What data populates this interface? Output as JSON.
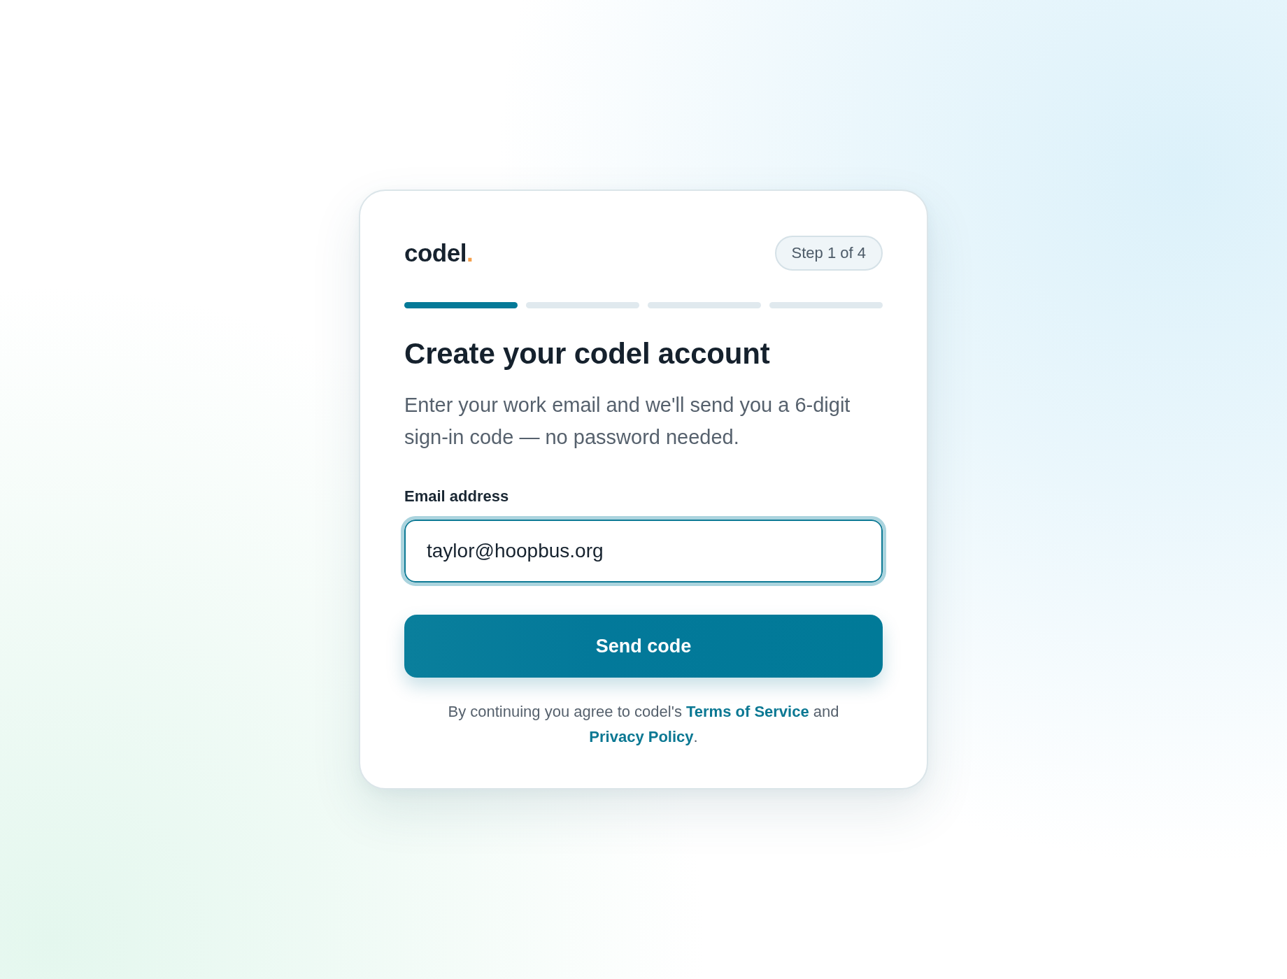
{
  "logo": {
    "name": "codel",
    "dot": "."
  },
  "step_badge": "Step 1 of 4",
  "progress": [
    {
      "active": true
    },
    {
      "active": false
    },
    {
      "active": false
    },
    {
      "active": false
    }
  ],
  "heading": "Create your codel account",
  "description": "Enter your work email and we'll send you a 6-digit sign-in code — no password needed.",
  "email_field": {
    "label": "Email address",
    "value": "taylor@hoopbus.org",
    "focused": true
  },
  "submit_button": {
    "label": "Send code"
  },
  "legal": [
    {
      "kind": "text",
      "text": "By continuing you agree to codel's "
    },
    {
      "kind": "link",
      "text": "Terms of Service"
    },
    {
      "kind": "text",
      "text": " and "
    },
    {
      "kind": "link",
      "text": "Privacy Policy"
    },
    {
      "kind": "text",
      "text": "."
    }
  ]
}
